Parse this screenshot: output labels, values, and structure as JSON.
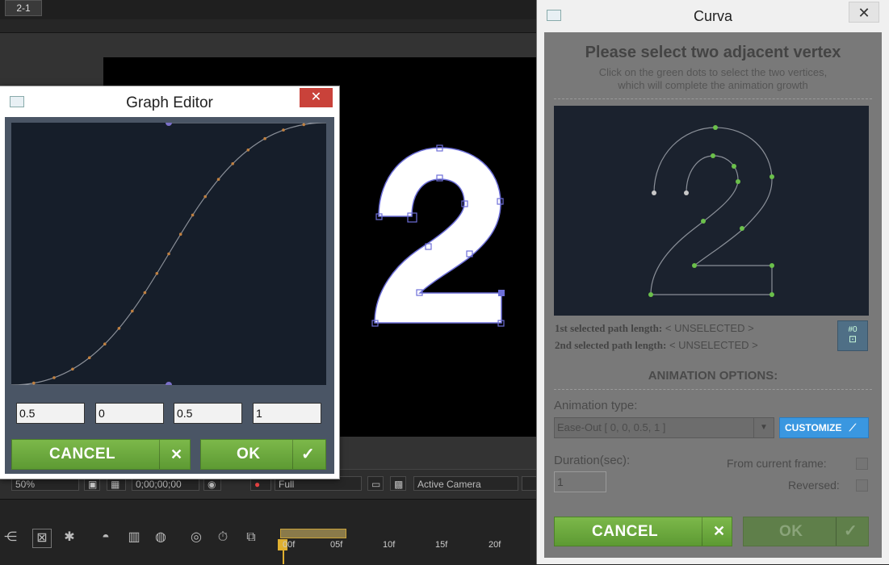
{
  "app": {
    "comp_tab": "2-1",
    "toolbar": {
      "zoom": "50%",
      "timecode": "0;00;00;00",
      "resolution": "Full",
      "camera": "Active Camera"
    },
    "timeline": {
      "ticks": [
        "00f",
        "05f",
        "10f",
        "15f",
        "20f"
      ]
    }
  },
  "graph_editor": {
    "title": "Graph Editor",
    "close_glyph": "✕",
    "fields": [
      "0.5",
      "0",
      "0.5",
      "1"
    ],
    "cancel_label": "CANCEL",
    "cancel_mark": "✕",
    "ok_label": "OK",
    "ok_mark": "✓"
  },
  "curva": {
    "title": "Curva",
    "close_glyph": "✕",
    "heading": "Please select two adjacent vertex",
    "sub_line1": "Click on the green dots to select the two vertices,",
    "sub_line2": "which will complete the animation growth",
    "path1_label": "1st selected path length:",
    "path1_value": "< UNSELECTED >",
    "path2_label": "2nd selected path length:",
    "path2_value": "< UNSELECTED >",
    "icon_button_text": "#0",
    "options_heading": "ANIMATION OPTIONS:",
    "animation_type_label": "Animation type:",
    "animation_type_value": "Ease-Out [ 0, 0, 0.5, 1 ]",
    "customize_label": "CUSTOMIZE",
    "duration_label": "Duration(sec):",
    "duration_value": "1",
    "from_current_frame_label": "From current frame:",
    "reversed_label": "Reversed:",
    "cancel_label": "CANCEL",
    "cancel_mark": "✕",
    "ok_label": "OK",
    "ok_mark": "✓"
  },
  "colors": {
    "accent_green": "#6aa83c",
    "customize_blue": "#3a97e0",
    "close_red": "#c9423a",
    "vertex_green": "#6bc04b",
    "handle_purple": "#7a70c8"
  }
}
